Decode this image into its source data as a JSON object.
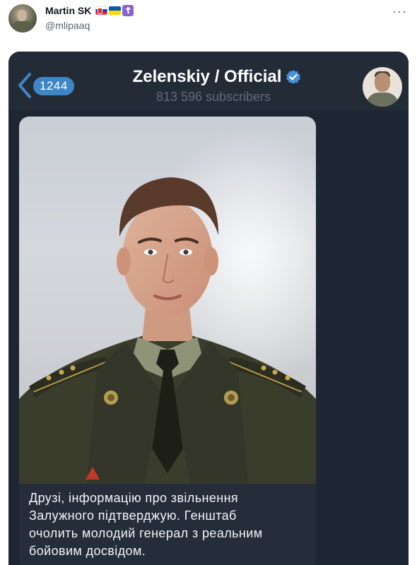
{
  "tweet": {
    "author_name": "Martin SK",
    "author_handle": "@mlipaaq",
    "flag_icons": [
      "slovakia-flag-icon",
      "ukraine-flag-icon",
      "orthodox-cross-icon"
    ],
    "more_icon": "more-dots-icon"
  },
  "telegram": {
    "back_icon": "chevron-left-icon",
    "unread_count": "1244",
    "channel_title": "Zelenskiy / Official",
    "verified_icon": "verified-badge-icon",
    "subscribers": "813 596 subscribers",
    "message_caption": "Друзі, інформацію про звільнення\nЗалужного підтверджую. Генштаб\nочолить молодий генерал з реальним\nбойовим досвідом."
  },
  "colors": {
    "accent_blue": "#3f86c7",
    "chat_background": "#1f2633",
    "header_background": "#232b37",
    "bubble_background": "#252d3a",
    "uniform_green": "#3b3d2c"
  }
}
